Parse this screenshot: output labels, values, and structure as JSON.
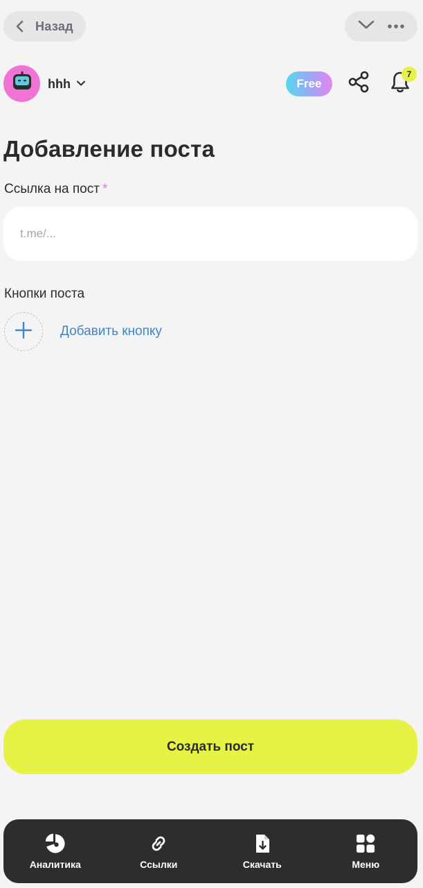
{
  "top_bar": {
    "back_label": "Назад",
    "back_icon": "chevron-left-icon",
    "collapse_icon": "chevron-down-icon",
    "more_icon": "more-horizontal-icon"
  },
  "header": {
    "avatar_icon": "robot-icon",
    "bot_name": "hhh",
    "bot_switch_icon": "chevron-down-icon",
    "plan_badge": "Free",
    "share_icon": "share-icon",
    "notifications_icon": "bell-icon",
    "notifications_count": "7"
  },
  "form": {
    "title": "Добавление поста",
    "link_label": "Ссылка на пост",
    "required_mark": "*",
    "link_value": "",
    "link_placeholder": "t.me/...",
    "buttons_label": "Кнопки поста",
    "add_button_label": "Добавить кнопку",
    "add_button_icon": "plus-icon",
    "submit_label": "Создать пост"
  },
  "bottom_nav": {
    "items": [
      {
        "label": "Аналитика",
        "icon": "pie-chart-icon"
      },
      {
        "label": "Ссылки",
        "icon": "link-icon"
      },
      {
        "label": "Скачать",
        "icon": "download-file-icon"
      },
      {
        "label": "Меню",
        "icon": "grid-menu-icon"
      }
    ]
  },
  "colors": {
    "background": "#f4f4f5",
    "accent_lime": "#e6f245",
    "avatar_pink": "#f074d6",
    "link_blue": "#3f86c6",
    "nav_dark": "#2d2d2f",
    "required_pink": "#e479d9"
  }
}
